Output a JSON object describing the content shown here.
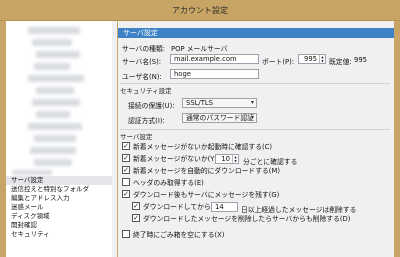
{
  "window": {
    "title": "アカウント設定"
  },
  "sidebar": {
    "items": [
      {
        "label": "サーバ設定",
        "selected": true
      },
      {
        "label": "送信控えと特別なフォルダ",
        "selected": false
      },
      {
        "label": "編集とアドレス入力",
        "selected": false
      },
      {
        "label": "迷惑メール",
        "selected": false
      },
      {
        "label": "ディスク領域",
        "selected": false
      },
      {
        "label": "開封確認",
        "selected": false
      },
      {
        "label": "セキュリティ",
        "selected": false
      }
    ]
  },
  "panel": {
    "header": "サーバ設定",
    "server_type_label": "サーバの種類:",
    "server_type_value": "POP メールサーバ",
    "server_name_label": "サーバ名(S):",
    "server_name_value": "mail.example.com",
    "port_label": "ポート(P):",
    "port_value": "995",
    "default_label": "既定値:",
    "default_value": "995",
    "username_label": "ユーザ名(N):",
    "username_value": "hoge",
    "security_header": "セキュリティ設定",
    "conn_security_label": "接続の保護(U):",
    "conn_security_value": "SSL/TLS",
    "auth_label": "認証方式(I):",
    "auth_value": "通常のパスワード認証",
    "server_settings_header": "サーバ設定",
    "check_on_startup": {
      "label": "新着メッセージがないか起動時に確認する(C)",
      "checked": true
    },
    "check_every": {
      "label_before": "新着メッセージがないか(Y)",
      "minutes": "10",
      "label_after": "分ごとに確認する",
      "checked": true
    },
    "auto_download": {
      "label": "新着メッセージを自動的にダウンロードする(M)",
      "checked": true
    },
    "headers_only": {
      "label": "ヘッダのみ取得する(E)",
      "checked": false
    },
    "leave_on_server": {
      "label": "ダウンロード後もサーバにメッセージを残す(G)",
      "checked": true
    },
    "delete_after_days": {
      "label_before": "ダウンロードしてから(O)",
      "days": "14",
      "label_after": "日以上経過したメッセージは削除する",
      "checked": true
    },
    "delete_when_deleted": {
      "label": "ダウンロードしたメッセージを削除したらサーバからも削除する(D)",
      "checked": true
    },
    "empty_trash": {
      "label": "終了時にごみ箱を空にする(X)",
      "checked": false
    }
  },
  "icons": {
    "dropdown": "chevron-down-icon",
    "spinner": "spinner-arrows-icon"
  }
}
